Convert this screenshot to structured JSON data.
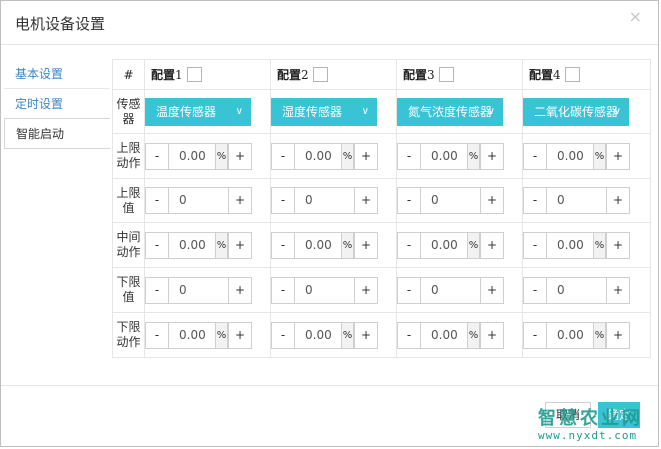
{
  "dialog": {
    "title": "电机设备设置",
    "close_glyph": "×"
  },
  "sidebar": {
    "items": [
      {
        "label": "基本设置"
      },
      {
        "label": "定时设置"
      },
      {
        "label": "智能启动",
        "active": true
      }
    ]
  },
  "table": {
    "hash": "#",
    "configs": [
      {
        "label": "配置",
        "num": "1",
        "checked": false,
        "sensor": "温度传感器"
      },
      {
        "label": "配置",
        "num": "2",
        "checked": false,
        "sensor": "湿度传感器"
      },
      {
        "label": "配置",
        "num": "3",
        "checked": false,
        "sensor": "氮气浓度传感器"
      },
      {
        "label": "配置",
        "num": "4",
        "checked": false,
        "sensor": "二氧化碳传感器"
      }
    ],
    "rows": {
      "sensor": [
        "传感",
        "器"
      ],
      "upper_action": [
        "上限",
        "动作"
      ],
      "upper_value": [
        "上限",
        "值"
      ],
      "middle_action": [
        "中间",
        "动作"
      ],
      "lower_value": [
        "下限",
        "值"
      ],
      "lower_action": [
        "下限",
        "动作"
      ]
    },
    "values": {
      "upper_action": [
        "0.00",
        "0.00",
        "0.00",
        "0.00"
      ],
      "upper_value": [
        "0",
        "0",
        "0",
        "0"
      ],
      "middle_action": [
        "0.00",
        "0.00",
        "0.00",
        "0.00"
      ],
      "lower_value": [
        "0",
        "0",
        "0",
        "0"
      ],
      "lower_action": [
        "0.00",
        "0.00",
        "0.00",
        "0.00"
      ]
    },
    "minus": "-",
    "plus": "+",
    "percent": "%"
  },
  "footer": {
    "cancel_label": "取消",
    "ok_label": "确定"
  },
  "watermark": {
    "title": "智慧农业网",
    "url": "www.nyxdt.com"
  },
  "colors": {
    "accent": "#38c4d4",
    "link": "#3a87c7",
    "watermark": "#1e9b8f"
  },
  "icons": {
    "close": "close-icon",
    "dropdown": "chevron-down-icon"
  }
}
